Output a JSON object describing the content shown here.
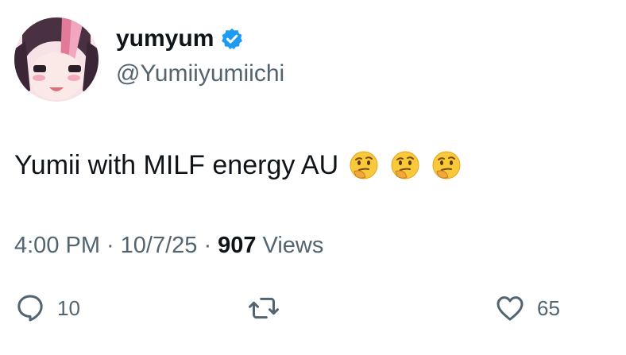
{
  "author": {
    "display_name": "yumyum",
    "handle": "@Yumiiyumiichi",
    "verified_icon": "verified-badge-icon",
    "avatar_icon": "anime-avatar",
    "accent_color": "#1d9bf0"
  },
  "tweet": {
    "text": "Yumii with MILF energy AU",
    "emojis": [
      "thinking-face-icon",
      "thinking-face-icon",
      "thinking-face-icon"
    ]
  },
  "meta": {
    "time": "4:00 PM",
    "separator": "·",
    "date": "10/7/25",
    "views_count": "907",
    "views_label": "Views"
  },
  "actions": {
    "reply_count": "10",
    "retweet_count": "",
    "like_count": "65"
  }
}
